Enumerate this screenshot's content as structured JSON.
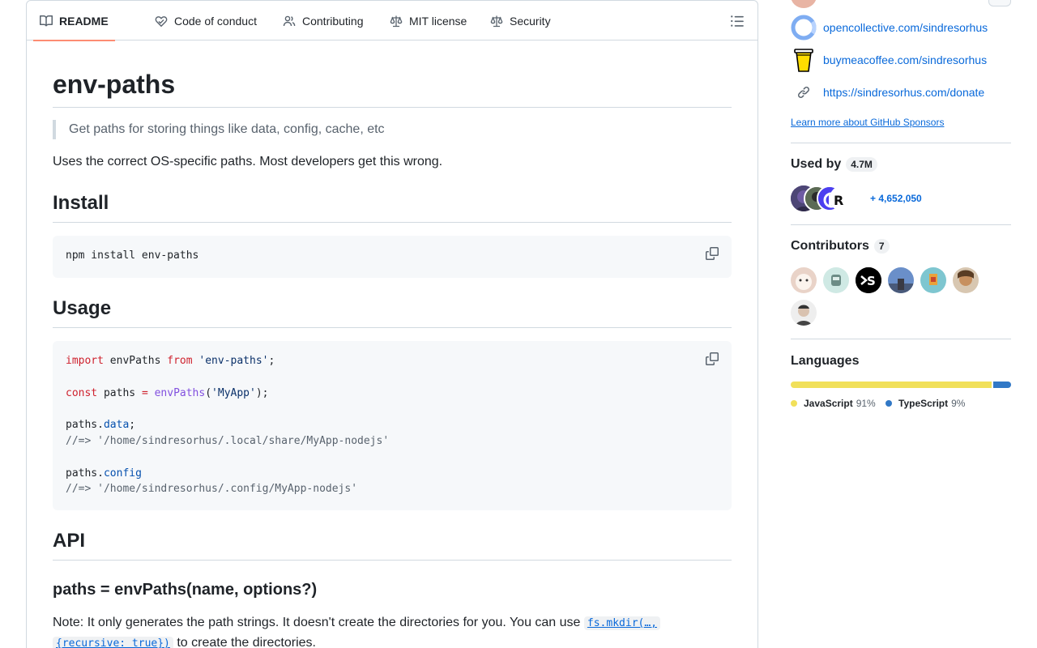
{
  "tabs": [
    {
      "label": "README",
      "icon": "book-icon",
      "active": true
    },
    {
      "label": "Code of conduct",
      "icon": "code-of-conduct-icon",
      "active": false
    },
    {
      "label": "Contributing",
      "icon": "people-icon",
      "active": false
    },
    {
      "label": "MIT license",
      "icon": "law-icon",
      "active": false
    },
    {
      "label": "Security",
      "icon": "law-icon",
      "active": false
    }
  ],
  "readme": {
    "title": "env-paths",
    "tagline": "Get paths for storing things like data, config, cache, etc",
    "intro": "Uses the correct OS-specific paths. Most developers get this wrong.",
    "install_heading": "Install",
    "install_code": "npm install env-paths",
    "usage_heading": "Usage",
    "usage_code": {
      "l1_kw": "import",
      "l1_name": "envPaths",
      "l1_from": "from",
      "l1_str": "'env-paths'",
      "l1_end": ";",
      "l2_kw": "const",
      "l2_name": "paths",
      "l2_eq": "=",
      "l2_fn": "envPaths",
      "l2_open": "(",
      "l2_str": "'MyApp'",
      "l2_end": ");",
      "l3_obj": "paths.",
      "l3_prop": "data",
      "l3_end": ";",
      "l4_cmt": "//=> '/home/sindresorhus/.local/share/MyApp-nodejs'",
      "l5_obj": "paths.",
      "l5_prop": "config",
      "l6_cmt": "//=> '/home/sindresorhus/.config/MyApp-nodejs'"
    },
    "api_heading": "API",
    "api_sub": "paths = envPaths(name, options?)",
    "note_text": "Note: It only generates the path strings. It doesn't create the directories for you. You can use",
    "note_code_1": "fs.mkdir(…,",
    "note_code_2": "{recursive: true})",
    "note_end": "to create the directories."
  },
  "sidebar": {
    "sponsors": [
      {
        "label": "opencollective.com/sindresorhus",
        "icon": "opencollective-icon"
      },
      {
        "label": "buymeacoffee.com/sindresorhus",
        "icon": "buymeacoffee-icon"
      },
      {
        "label": "https://sindresorhus.com/donate",
        "icon": "link-icon"
      }
    ],
    "sponsors_learn_more": "Learn more about GitHub Sponsors",
    "used_by": {
      "heading": "Used by",
      "count": "4.7M",
      "more": "+ 4,652,050"
    },
    "contributors": {
      "heading": "Contributors",
      "count": "7"
    },
    "languages": {
      "heading": "Languages",
      "items": [
        {
          "name": "JavaScript",
          "percent": "91%",
          "value": 91,
          "color": "#f1e05a"
        },
        {
          "name": "TypeScript",
          "percent": "9%",
          "value": 9,
          "color": "#3178c6"
        }
      ]
    }
  }
}
